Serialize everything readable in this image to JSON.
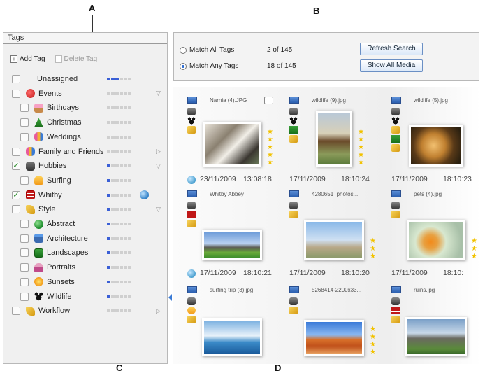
{
  "callouts": [
    "A",
    "B",
    "C",
    "D"
  ],
  "tags_panel": {
    "title": "Tags",
    "add_tag": "Add Tag",
    "delete_tag": "Delete Tag",
    "items": [
      {
        "label": "Unassigned",
        "checked": false,
        "indent": 0,
        "icon": "none",
        "meter": 3,
        "chevron": ""
      },
      {
        "label": "Events",
        "checked": false,
        "indent": 0,
        "icon": "balloons-icon",
        "meter": 0,
        "chevron": "▽"
      },
      {
        "label": "Birthdays",
        "checked": false,
        "indent": 1,
        "icon": "cake-icon",
        "meter": 0,
        "chevron": ""
      },
      {
        "label": "Christmas",
        "checked": false,
        "indent": 1,
        "icon": "tree-icon",
        "meter": 0,
        "chevron": ""
      },
      {
        "label": "Weddings",
        "checked": false,
        "indent": 1,
        "icon": "people-icon",
        "meter": 0,
        "chevron": ""
      },
      {
        "label": "Family and Friends",
        "checked": false,
        "indent": 0,
        "icon": "people-icon",
        "meter": 0,
        "chevron": "▷"
      },
      {
        "label": "Hobbies",
        "checked": true,
        "indent": 0,
        "icon": "camera-icon",
        "meter": 1,
        "chevron": "▽"
      },
      {
        "label": "Surfing",
        "checked": false,
        "indent": 1,
        "icon": "surfer-icon",
        "meter": 1,
        "chevron": ""
      },
      {
        "label": "Whitby",
        "checked": true,
        "indent": 0,
        "icon": "grid-tag-icon",
        "meter": 1,
        "chevron": "",
        "globe": true
      },
      {
        "label": "Style",
        "checked": false,
        "indent": 0,
        "icon": "pen-icon",
        "meter": 1,
        "chevron": "▽"
      },
      {
        "label": "Abstract",
        "checked": false,
        "indent": 1,
        "icon": "sphere-icon",
        "meter": 1,
        "chevron": ""
      },
      {
        "label": "Architecture",
        "checked": false,
        "indent": 1,
        "icon": "house-icon",
        "meter": 1,
        "chevron": ""
      },
      {
        "label": "Landscapes",
        "checked": false,
        "indent": 1,
        "icon": "landscape-icon",
        "meter": 1,
        "chevron": ""
      },
      {
        "label": "Portraits",
        "checked": false,
        "indent": 1,
        "icon": "person-icon",
        "meter": 1,
        "chevron": ""
      },
      {
        "label": "Sunsets",
        "checked": false,
        "indent": 1,
        "icon": "sun-icon",
        "meter": 1,
        "chevron": ""
      },
      {
        "label": "Wildlife",
        "checked": false,
        "indent": 1,
        "icon": "paw-icon",
        "meter": 1,
        "chevron": ""
      },
      {
        "label": "Workflow",
        "checked": false,
        "indent": 0,
        "icon": "pen-icon",
        "meter": 0,
        "chevron": "▷"
      }
    ]
  },
  "search": {
    "match_all": "Match All Tags",
    "match_all_count": "2 of 145",
    "match_any": "Match Any Tags",
    "match_any_count": "18 of 145",
    "selected": "match_any",
    "refresh": "Refresh Search",
    "show_all": "Show All Media"
  },
  "media": {
    "rows": [
      {
        "items": [
          {
            "name": "Narnia (4).JPG",
            "stars": 5,
            "theme": "tiger",
            "has_comment": true
          },
          {
            "name": "wildlife (9).jpg",
            "stars": 5,
            "theme": "deer"
          },
          {
            "name": "wildlife (5).jpg",
            "stars": 0,
            "theme": "lion"
          }
        ],
        "dates": [
          {
            "date": "23/11/2009",
            "time": "13:08:18"
          },
          {
            "date": "17/11/2009",
            "time": "18:10:24"
          },
          {
            "date": "17/11/2009",
            "time": "18:10:23"
          }
        ]
      },
      {
        "items": [
          {
            "name": "Whitby Abbey",
            "stars": 0,
            "theme": "abbey"
          },
          {
            "name": "4280651_photos....",
            "stars": 3,
            "theme": "horse"
          },
          {
            "name": "pets (4).jpg",
            "stars": 3,
            "theme": "fish"
          }
        ],
        "dates": [
          {
            "date": "17/11/2009",
            "time": "18:10:21"
          },
          {
            "date": "17/11/2009",
            "time": "18:10:20"
          },
          {
            "date": "17/11/2009",
            "time": "18:10:"
          }
        ]
      },
      {
        "items": [
          {
            "name": "surfing trip (3).jpg",
            "stars": 0,
            "theme": "surf"
          },
          {
            "name": "5268414-2200x33...",
            "stars": 4,
            "theme": "desert"
          },
          {
            "name": "ruins.jpg",
            "stars": 0,
            "theme": "ruins"
          }
        ],
        "dates": []
      }
    ]
  },
  "colors": {
    "meter_on": "#3a5fd6",
    "star": "#f2c200",
    "accent_blue": "#3a7bd5"
  }
}
